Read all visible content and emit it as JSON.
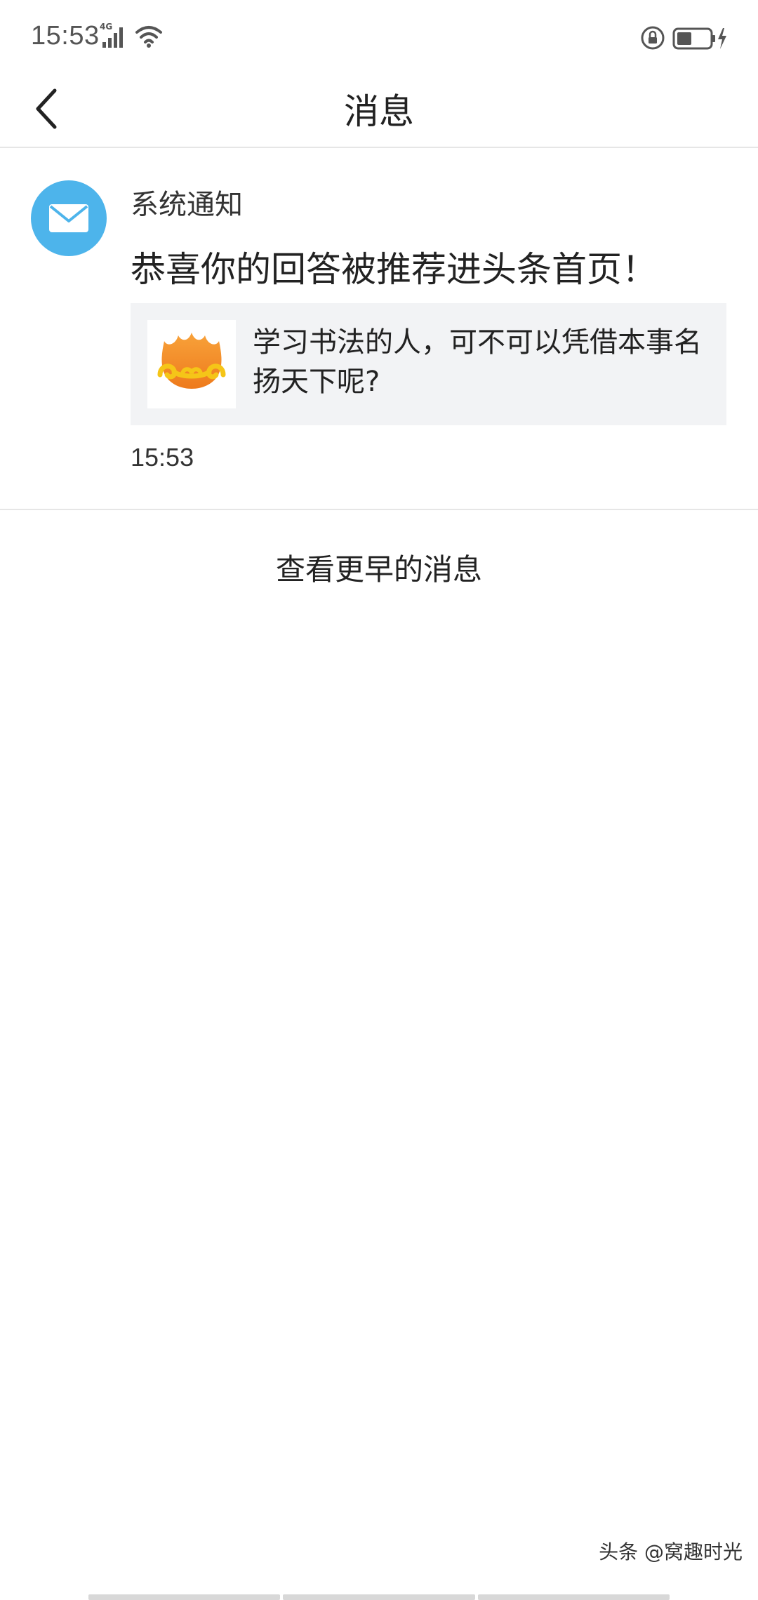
{
  "status_bar": {
    "time": "15:53",
    "network": "4G",
    "icons": [
      "signal-icon",
      "wifi-icon",
      "rotation-lock-icon",
      "battery-icon"
    ]
  },
  "header": {
    "title": "消息",
    "back_icon": "chevron-left-icon"
  },
  "message": {
    "sender": "系统通知",
    "avatar_icon": "envelope-icon",
    "text": "恭喜你的回答被推荐进头条首页！",
    "quote": {
      "thumb_icon": "flame-cloud-icon",
      "title": "学习书法的人，可不可以凭借本事名扬天下呢?"
    },
    "time": "15:53"
  },
  "earlier_messages_label": "查看更早的消息",
  "watermark": "头条 @窝趣时光",
  "colors": {
    "avatar_bg": "#4db4eb",
    "quote_bg": "#f2f3f5",
    "divider": "#e6e6e6",
    "thumb_flame": "#f08a24",
    "thumb_swirl": "#f5c518"
  }
}
